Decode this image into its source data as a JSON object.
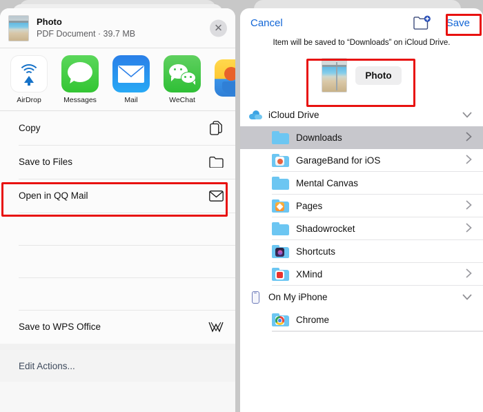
{
  "share_sheet": {
    "document": {
      "title": "Photo",
      "subtitle": "PDF Document · 39.7 MB",
      "close_label": "✕"
    },
    "apps": [
      {
        "label": "AirDrop",
        "icon": "airdrop-icon"
      },
      {
        "label": "Messages",
        "icon": "messages-icon"
      },
      {
        "label": "Mail",
        "icon": "mail-icon"
      },
      {
        "label": "WeChat",
        "icon": "wechat-icon"
      },
      {
        "label": "",
        "icon": "partial-app-icon"
      }
    ],
    "actions": [
      {
        "label": "Copy",
        "icon": "copy-icon",
        "highlighted": false
      },
      {
        "label": "Save to Files",
        "icon": "folder-icon",
        "highlighted": true
      },
      {
        "label": "Open in QQ Mail",
        "icon": "envelope-icon",
        "highlighted": false
      }
    ],
    "blank_rows": 3,
    "actions_bottom": [
      {
        "label": "Save to WPS Office",
        "icon": "wps-icon"
      }
    ],
    "edit_actions_label": "Edit Actions..."
  },
  "files_dialog": {
    "cancel_label": "Cancel",
    "save_label": "Save",
    "new_folder_icon": "new-folder-icon",
    "note": "Item will be saved to “Downloads” on iCloud Drive.",
    "item": {
      "name": "Photo",
      "thumbnail": "photo-thumbnail"
    },
    "locations": [
      {
        "label": "iCloud Drive",
        "icon": "icloud-icon",
        "expanded": true,
        "chevron": "chevron-down",
        "folders": [
          {
            "label": "Downloads",
            "badge": "none",
            "chevron": true,
            "selected": true
          },
          {
            "label": "GarageBand for iOS",
            "badge": "garageband",
            "chevron": true,
            "selected": false
          },
          {
            "label": "Mental Canvas",
            "badge": "none",
            "chevron": false,
            "selected": false
          },
          {
            "label": "Pages",
            "badge": "pages",
            "chevron": true,
            "selected": false
          },
          {
            "label": "Shadowrocket",
            "badge": "none",
            "chevron": true,
            "selected": false
          },
          {
            "label": "Shortcuts",
            "badge": "shortcuts",
            "chevron": false,
            "selected": false
          },
          {
            "label": "XMind",
            "badge": "xmind",
            "chevron": true,
            "selected": false
          }
        ]
      },
      {
        "label": "On My iPhone",
        "icon": "iphone-icon",
        "expanded": true,
        "chevron": "chevron-down",
        "folders": [
          {
            "label": "Chrome",
            "badge": "chrome",
            "chevron": false,
            "selected": false
          }
        ]
      }
    ]
  },
  "annotations": {
    "highlight_color": "#e8110f",
    "boxes": [
      {
        "target": "Save to Files action row"
      },
      {
        "target": "Save button"
      },
      {
        "target": "Item name preview"
      }
    ]
  }
}
